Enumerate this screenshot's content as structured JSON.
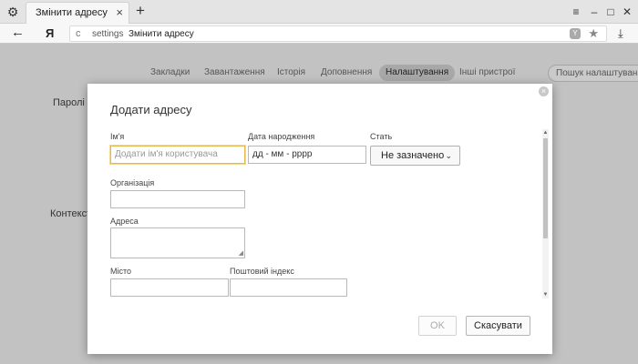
{
  "tab": {
    "title": "Змінити адресу",
    "close": "×"
  },
  "icons": {
    "settings": "⚙",
    "new_tab": "+",
    "menu": "≡",
    "minimize": "–",
    "maximize": "□",
    "close": "✕",
    "back": "←",
    "reload": "c",
    "star": "★",
    "download": "⤓",
    "protect": "Y",
    "dialog_close": "×",
    "chevron": "⌄",
    "resize": "◢",
    "scroll_up": "▲",
    "scroll_down": "▼"
  },
  "browser": {
    "logo": "Я"
  },
  "address": {
    "host": "settings",
    "page": "Змінити адресу"
  },
  "settings_nav": [
    "Закладки",
    "Завантаження",
    "Історія",
    "Доповнення",
    "Налаштування",
    "Інші пристрої"
  ],
  "settings_active": "Налаштування",
  "settings_search": {
    "placeholder": "Пошук налаштувань"
  },
  "background_labels": {
    "passwords": "Паролі",
    "context": "Контекст"
  },
  "dialog": {
    "title": "Додати адресу",
    "name_label": "Ім'я",
    "name_placeholder": "Додати ім'я користувача",
    "birthdate_label": "Дата народження",
    "birthdate_placeholder": "дд - мм - рррр",
    "gender_label": "Стать",
    "gender_value": "Не зазначено",
    "organization_label": "Організація",
    "address_label": "Адреса",
    "city_label": "Місто",
    "postcode_label": "Поштовий індекс",
    "ok_label": "OK",
    "cancel_label": "Скасувати"
  }
}
